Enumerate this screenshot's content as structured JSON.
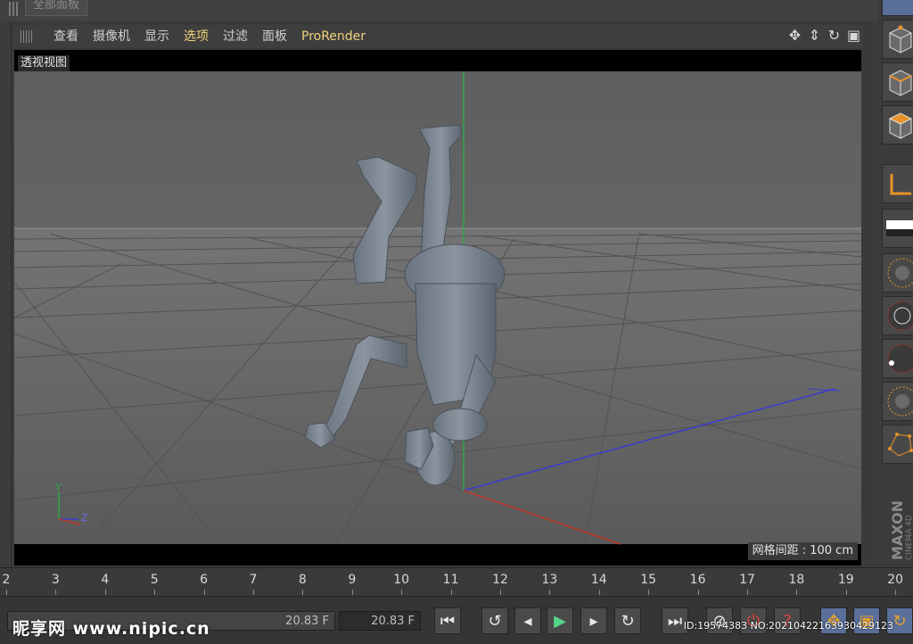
{
  "top_panel": {
    "tab_label": "全部面板"
  },
  "viewport_menu": {
    "items": [
      "查看",
      "摄像机",
      "显示",
      "选项",
      "过滤",
      "面板",
      "ProRender"
    ],
    "active_index": 3
  },
  "nav_icons": [
    "move-icon",
    "zoom-icon",
    "rotate-icon",
    "maximize-icon"
  ],
  "viewport": {
    "title": "透视视图",
    "grid_spacing": "网格间距 : 100 cm",
    "axis_labels": {
      "y": "Y",
      "z": "Z"
    }
  },
  "timeline": {
    "ticks": [
      "2",
      "3",
      "4",
      "5",
      "6",
      "7",
      "8",
      "9",
      "10",
      "11",
      "12",
      "13",
      "14",
      "15",
      "16",
      "17",
      "18",
      "19",
      "20"
    ]
  },
  "transport": {
    "current_frame_left": "20.83 F",
    "current_frame_right": "20.83 F",
    "buttons": [
      "go-to-start",
      "prev-key",
      "prev-frame",
      "play",
      "next-frame",
      "next-key",
      "go-to-end",
      "record",
      "autokey",
      "key-help",
      "move-key",
      "scale-key",
      "rotate-key"
    ]
  },
  "watermark": {
    "site": "昵享网 www.nipic.cn",
    "id": "ID:19574383 NO:20210422163930429123"
  },
  "brand": {
    "text": "MAXON CINEMA 4D"
  },
  "colors": {
    "viewport_bg": "#6b6b6b",
    "grid_line": "#4f4f4f",
    "y_axis": "#2fa84a",
    "z_axis": "#3b3bd0",
    "x_axis": "#c0392b",
    "accent": "#f0d27a",
    "orange": "#e8922a"
  }
}
